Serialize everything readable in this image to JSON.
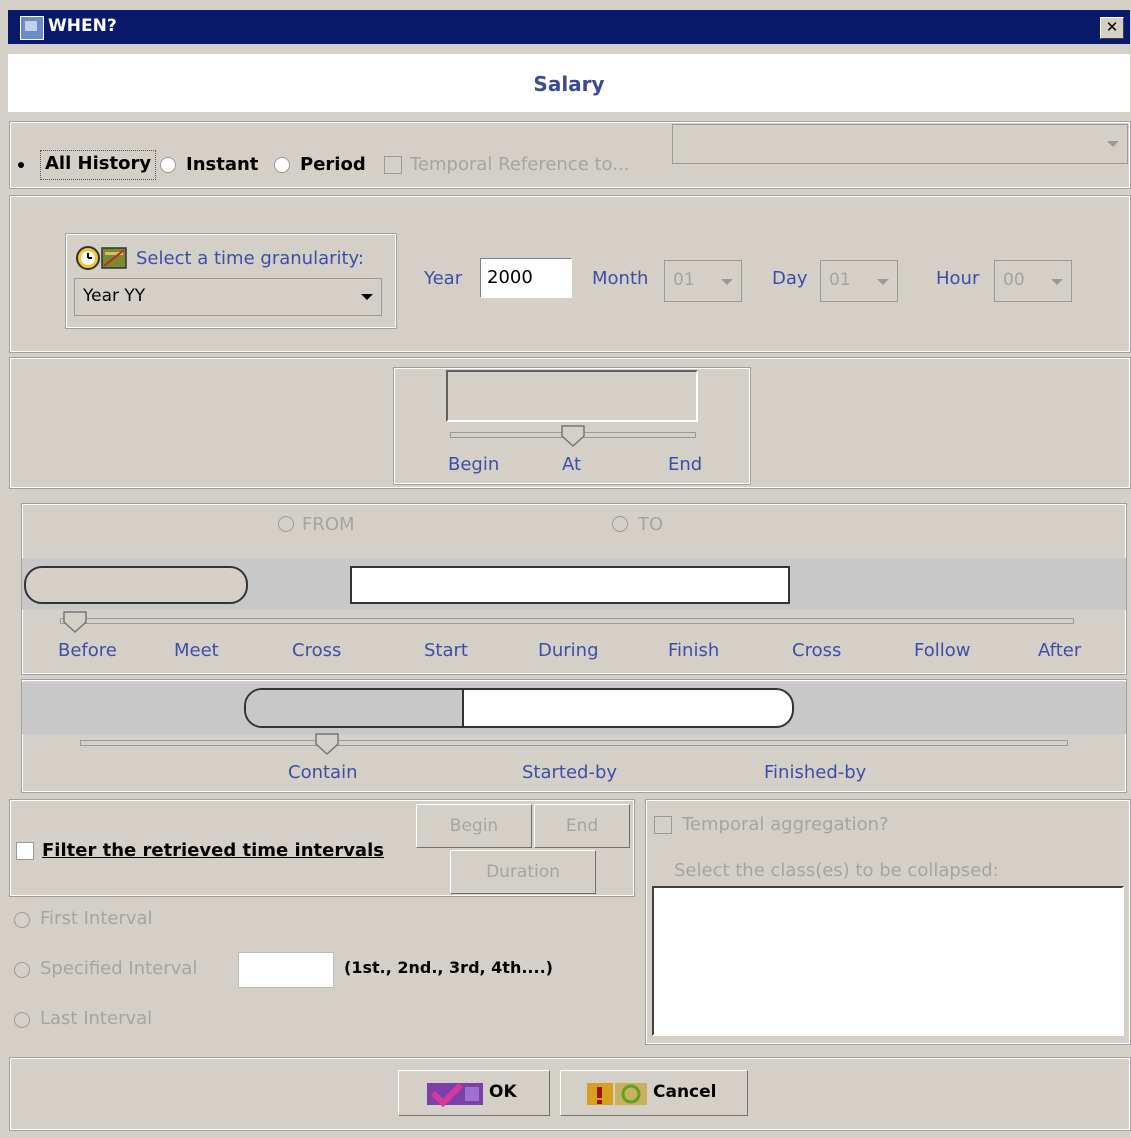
{
  "window": {
    "title": "WHEN?",
    "close_glyph": "✕"
  },
  "header": {
    "title": "Salary"
  },
  "mode": {
    "all_history": "All History",
    "instant": "Instant",
    "period": "Period",
    "temporal_reference": "Temporal Reference to...",
    "selected": "All History"
  },
  "granularity": {
    "label": "Select a time granularity:",
    "value": "Year YY",
    "icon": "clock-calendar-icon"
  },
  "date": {
    "year_label": "Year",
    "year_value": "2000",
    "month_label": "Month",
    "month_value": "01",
    "day_label": "Day",
    "day_value": "01",
    "hour_label": "Hour",
    "hour_value": "00"
  },
  "instant_slider": {
    "labels": [
      "Begin",
      "At",
      "End"
    ],
    "selected": "At"
  },
  "period_options": {
    "from": "FROM",
    "to": "TO"
  },
  "relation_slider": {
    "labels": [
      "Before",
      "Meet",
      "Cross",
      "Start",
      "During",
      "Finish",
      "Cross",
      "Follow",
      "After"
    ],
    "selected": "Before"
  },
  "contain_slider": {
    "labels": [
      "Contain",
      "Started-by",
      "Finished-by"
    ],
    "selected": "Contain"
  },
  "filter": {
    "label": "Filter the retrieved time intervals",
    "begin": "Begin",
    "end": "End",
    "duration": "Duration",
    "first": "First Interval",
    "specified": "Specified Interval",
    "specified_hint": "(1st., 2nd., 3rd, 4th....)",
    "last": "Last Interval"
  },
  "aggregation": {
    "label": "Temporal aggregation?",
    "collapse_label": "Select the class(es) to be collapsed:"
  },
  "footer": {
    "ok": "OK",
    "cancel": "Cancel"
  },
  "colors": {
    "title_bar": "#0a1a6a",
    "label_blue": "#3e4ea8",
    "disabled_grey": "#a4a4a4",
    "background": "#d4d0c8"
  }
}
